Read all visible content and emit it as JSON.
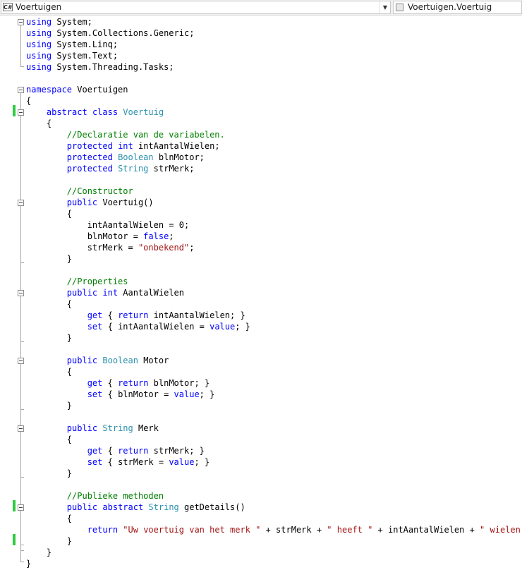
{
  "navigation": {
    "type_icon": "csharp-file-icon",
    "type_label": "C#",
    "type_selector": "Voertuigen",
    "member_icon": "class-member-icon",
    "member_selector": "Voertuigen.Voertuig"
  },
  "code_lines": [
    [
      {
        "t": "using",
        "c": "kw"
      },
      {
        "t": " System;",
        "c": ""
      }
    ],
    [
      {
        "t": "using",
        "c": "kw"
      },
      {
        "t": " System.Collections.Generic;",
        "c": ""
      }
    ],
    [
      {
        "t": "using",
        "c": "kw"
      },
      {
        "t": " System.Linq;",
        "c": ""
      }
    ],
    [
      {
        "t": "using",
        "c": "kw"
      },
      {
        "t": " System.Text;",
        "c": ""
      }
    ],
    [
      {
        "t": "using",
        "c": "kw"
      },
      {
        "t": " System.Threading.Tasks;",
        "c": ""
      }
    ],
    [],
    [
      {
        "t": "namespace",
        "c": "kw"
      },
      {
        "t": " Voertuigen",
        "c": ""
      }
    ],
    [
      {
        "t": "{",
        "c": ""
      }
    ],
    [
      {
        "t": "    ",
        "c": ""
      },
      {
        "t": "abstract",
        "c": "kw"
      },
      {
        "t": " ",
        "c": ""
      },
      {
        "t": "class",
        "c": "kw"
      },
      {
        "t": " ",
        "c": ""
      },
      {
        "t": "Voertuig",
        "c": "ty"
      }
    ],
    [
      {
        "t": "    {",
        "c": ""
      }
    ],
    [
      {
        "t": "        ",
        "c": ""
      },
      {
        "t": "//Declaratie van de variabelen.",
        "c": "cm"
      }
    ],
    [
      {
        "t": "        ",
        "c": ""
      },
      {
        "t": "protected",
        "c": "kw"
      },
      {
        "t": " ",
        "c": ""
      },
      {
        "t": "int",
        "c": "kw"
      },
      {
        "t": " intAantalWielen;",
        "c": ""
      }
    ],
    [
      {
        "t": "        ",
        "c": ""
      },
      {
        "t": "protected",
        "c": "kw"
      },
      {
        "t": " ",
        "c": ""
      },
      {
        "t": "Boolean",
        "c": "ty"
      },
      {
        "t": " blnMotor;",
        "c": ""
      }
    ],
    [
      {
        "t": "        ",
        "c": ""
      },
      {
        "t": "protected",
        "c": "kw"
      },
      {
        "t": " ",
        "c": ""
      },
      {
        "t": "String",
        "c": "ty"
      },
      {
        "t": " strMerk;",
        "c": ""
      }
    ],
    [],
    [
      {
        "t": "        ",
        "c": ""
      },
      {
        "t": "//Constructor",
        "c": "cm"
      }
    ],
    [
      {
        "t": "        ",
        "c": ""
      },
      {
        "t": "public",
        "c": "kw"
      },
      {
        "t": " Voertuig()",
        "c": ""
      }
    ],
    [
      {
        "t": "        {",
        "c": ""
      }
    ],
    [
      {
        "t": "            intAantalWielen = 0;",
        "c": ""
      }
    ],
    [
      {
        "t": "            blnMotor = ",
        "c": ""
      },
      {
        "t": "false",
        "c": "kw"
      },
      {
        "t": ";",
        "c": ""
      }
    ],
    [
      {
        "t": "            strMerk = ",
        "c": ""
      },
      {
        "t": "\"onbekend\"",
        "c": "st"
      },
      {
        "t": ";",
        "c": ""
      }
    ],
    [
      {
        "t": "        }",
        "c": ""
      }
    ],
    [],
    [
      {
        "t": "        ",
        "c": ""
      },
      {
        "t": "//Properties",
        "c": "cm"
      }
    ],
    [
      {
        "t": "        ",
        "c": ""
      },
      {
        "t": "public",
        "c": "kw"
      },
      {
        "t": " ",
        "c": ""
      },
      {
        "t": "int",
        "c": "kw"
      },
      {
        "t": " AantalWielen",
        "c": ""
      }
    ],
    [
      {
        "t": "        {",
        "c": ""
      }
    ],
    [
      {
        "t": "            ",
        "c": ""
      },
      {
        "t": "get",
        "c": "kw"
      },
      {
        "t": " { ",
        "c": ""
      },
      {
        "t": "return",
        "c": "kw"
      },
      {
        "t": " intAantalWielen; }",
        "c": ""
      }
    ],
    [
      {
        "t": "            ",
        "c": ""
      },
      {
        "t": "set",
        "c": "kw"
      },
      {
        "t": " { intAantalWielen = ",
        "c": ""
      },
      {
        "t": "value",
        "c": "kw"
      },
      {
        "t": "; }",
        "c": ""
      }
    ],
    [
      {
        "t": "        }",
        "c": ""
      }
    ],
    [],
    [
      {
        "t": "        ",
        "c": ""
      },
      {
        "t": "public",
        "c": "kw"
      },
      {
        "t": " ",
        "c": ""
      },
      {
        "t": "Boolean",
        "c": "ty"
      },
      {
        "t": " Motor",
        "c": ""
      }
    ],
    [
      {
        "t": "        {",
        "c": ""
      }
    ],
    [
      {
        "t": "            ",
        "c": ""
      },
      {
        "t": "get",
        "c": "kw"
      },
      {
        "t": " { ",
        "c": ""
      },
      {
        "t": "return",
        "c": "kw"
      },
      {
        "t": " blnMotor; }",
        "c": ""
      }
    ],
    [
      {
        "t": "            ",
        "c": ""
      },
      {
        "t": "set",
        "c": "kw"
      },
      {
        "t": " { blnMotor = ",
        "c": ""
      },
      {
        "t": "value",
        "c": "kw"
      },
      {
        "t": "; }",
        "c": ""
      }
    ],
    [
      {
        "t": "        }",
        "c": ""
      }
    ],
    [],
    [
      {
        "t": "        ",
        "c": ""
      },
      {
        "t": "public",
        "c": "kw"
      },
      {
        "t": " ",
        "c": ""
      },
      {
        "t": "String",
        "c": "ty"
      },
      {
        "t": " Merk",
        "c": ""
      }
    ],
    [
      {
        "t": "        {",
        "c": ""
      }
    ],
    [
      {
        "t": "            ",
        "c": ""
      },
      {
        "t": "get",
        "c": "kw"
      },
      {
        "t": " { ",
        "c": ""
      },
      {
        "t": "return",
        "c": "kw"
      },
      {
        "t": " strMerk; }",
        "c": ""
      }
    ],
    [
      {
        "t": "            ",
        "c": ""
      },
      {
        "t": "set",
        "c": "kw"
      },
      {
        "t": " { strMerk = ",
        "c": ""
      },
      {
        "t": "value",
        "c": "kw"
      },
      {
        "t": "; }",
        "c": ""
      }
    ],
    [
      {
        "t": "        }",
        "c": ""
      }
    ],
    [],
    [
      {
        "t": "        ",
        "c": ""
      },
      {
        "t": "//Publieke methoden",
        "c": "cm"
      }
    ],
    [
      {
        "t": "        ",
        "c": ""
      },
      {
        "t": "public",
        "c": "kw"
      },
      {
        "t": " ",
        "c": ""
      },
      {
        "t": "abstract",
        "c": "kw"
      },
      {
        "t": " ",
        "c": ""
      },
      {
        "t": "String",
        "c": "ty"
      },
      {
        "t": " getDetails()",
        "c": ""
      }
    ],
    [
      {
        "t": "        {",
        "c": ""
      }
    ],
    [
      {
        "t": "            ",
        "c": ""
      },
      {
        "t": "return",
        "c": "kw"
      },
      {
        "t": " ",
        "c": ""
      },
      {
        "t": "\"Uw voertuig van het merk \"",
        "c": "st"
      },
      {
        "t": " + strMerk + ",
        "c": ""
      },
      {
        "t": "\" heeft \"",
        "c": "st"
      },
      {
        "t": " + intAantalWielen + ",
        "c": ""
      },
      {
        "t": "\" wielen.\"",
        "c": "st"
      },
      {
        "t": ";",
        "c": ""
      }
    ],
    [
      {
        "t": "        }",
        "c": ""
      }
    ],
    [
      {
        "t": "    }",
        "c": ""
      }
    ],
    [
      {
        "t": "}",
        "c": ""
      }
    ]
  ],
  "colors": {
    "keyword": "#0000ff",
    "type": "#2b91af",
    "comment": "#008000",
    "string": "#a31515",
    "change_marker": "#2ecc40"
  }
}
